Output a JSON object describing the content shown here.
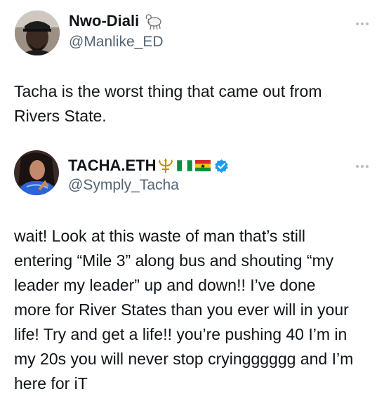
{
  "tweets": [
    {
      "author": {
        "name": "Nwo-Diali",
        "handle": "@Manlike_ED",
        "name_emoji": "ram-icon"
      },
      "text": "Tacha is the worst thing that came out from Rivers State."
    },
    {
      "author": {
        "name": "TACHA.ETH",
        "handle": "@Symply_Tacha",
        "name_emojis": [
          "trident-icon",
          "nigeria-flag-icon",
          "ghana-flag-icon"
        ],
        "verified": true
      },
      "text_lines": [
        "wait! Look at this waste of man that’s still",
        "entering “Mile 3” along bus and shouting “my",
        "leader my leader” up and down!! I’ve done",
        "more for River States than you ever will in your",
        "life! Try and get a life!! you’re pushing 40 I’m in",
        "my 20s you will never stop cryingggggg and I’m",
        "here for iT"
      ]
    }
  ],
  "colors": {
    "text": "#0f1419",
    "handle": "#536471",
    "verified": "#1d9bf0",
    "more_dots": "#b7bec4"
  }
}
